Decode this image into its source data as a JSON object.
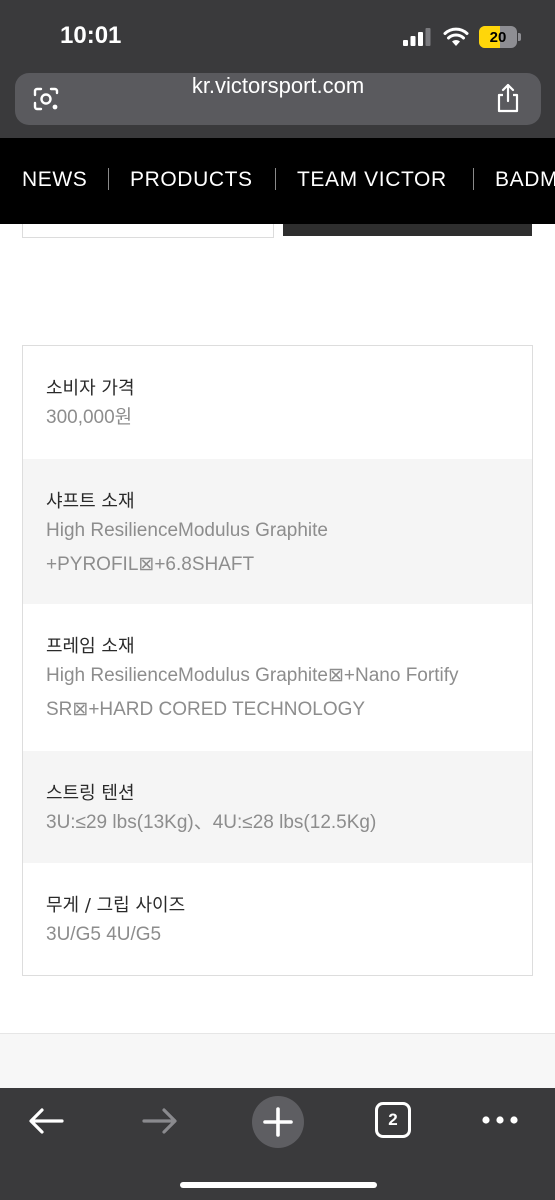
{
  "status_bar": {
    "time": "10:01",
    "battery_level": "20"
  },
  "browser": {
    "url": "kr.victorsport.com",
    "tab_count": "2"
  },
  "site_nav": {
    "items": [
      "NEWS",
      "PRODUCTS",
      "TEAM VICTOR",
      "BADMINTON"
    ]
  },
  "specs": [
    {
      "label": "소비자 가격",
      "value": "300,000원"
    },
    {
      "label": "샤프트 소재",
      "value": "High ResilienceModulus Graphite +PYROFIL⊠+6.8SHAFT"
    },
    {
      "label": "프레임 소재",
      "value": "High ResilienceModulus Graphite⊠+Nano Fortify SR⊠+HARD CORED TECHNOLOGY"
    },
    {
      "label": "스트링 텐션",
      "value": "3U:≤29 lbs(13Kg)、4U:≤28 lbs(12.5Kg)"
    },
    {
      "label": "무게 / 그립 사이즈",
      "value": "3U/G5 4U/G5"
    }
  ],
  "colors": {
    "chrome": "#3a3a3c",
    "nav_background": "#000000",
    "battery": "#ffd60a",
    "alt_row": "#f5f5f5"
  },
  "icons": [
    "google-lens-icon",
    "share-icon",
    "back-arrow-icon",
    "forward-arrow-icon",
    "plus-icon",
    "tabs-icon",
    "more-icon"
  ]
}
